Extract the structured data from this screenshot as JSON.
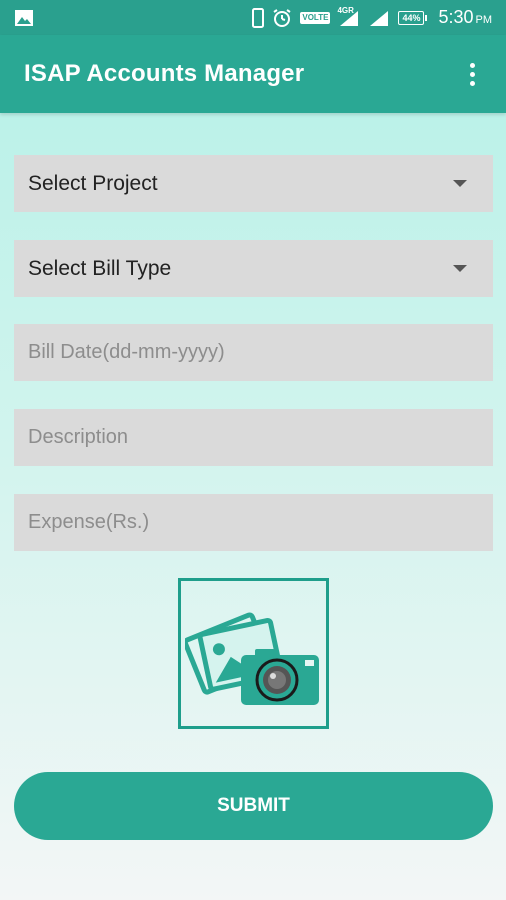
{
  "status_bar": {
    "network_badge": "VOLTE",
    "network_type": "4GR",
    "battery": "44%",
    "time": "5:30",
    "time_suffix": "PM"
  },
  "app_bar": {
    "title": "ISAP Accounts Manager",
    "overflow_icon": "more-vert-icon"
  },
  "form": {
    "project_select": {
      "selected": "Select Project"
    },
    "bill_type_select": {
      "selected": "Select Bill Type"
    },
    "bill_date": {
      "placeholder": "Bill Date(dd-mm-yyyy)",
      "value": ""
    },
    "description": {
      "placeholder": "Description",
      "value": ""
    },
    "expense": {
      "placeholder": "Expense(Rs.)",
      "value": ""
    },
    "photo_button_icon": "camera-photos-icon",
    "submit_label": "SUBMIT"
  },
  "colors": {
    "primary": "#2aa894",
    "status_bar": "#2aa08e",
    "field_bg": "#dadada",
    "photo_border": "#1e9e8b"
  }
}
